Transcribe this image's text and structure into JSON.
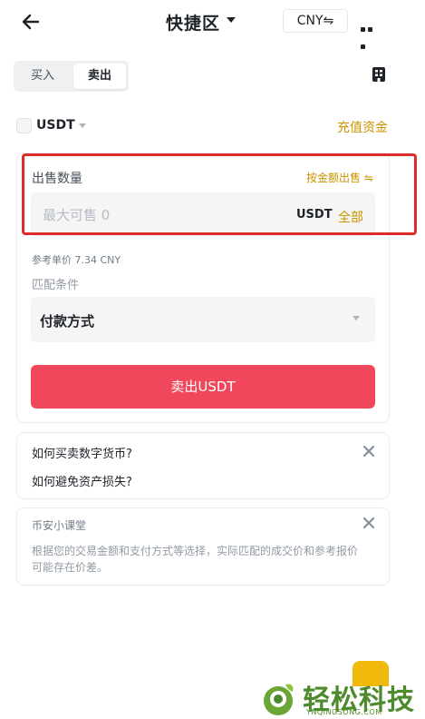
{
  "header": {
    "title": "快捷区",
    "currency_button": "CNY⇋"
  },
  "tabs": [
    {
      "label": "买入",
      "active": false
    },
    {
      "label": "卖出",
      "active": true
    }
  ],
  "coin_row": {
    "coin": "USDT",
    "recharge_link": "充值资金"
  },
  "sell_form": {
    "quantity_label": "出售数量",
    "by_amount_link": "按金额出售 ⇋",
    "quantity_placeholder": "最大可售 0",
    "unit": "USDT",
    "all_button": "全部",
    "reference_price": "参考单价 7.34 CNY",
    "match_label": "匹配条件",
    "payment_method": "付款方式",
    "submit_button": "卖出USDT"
  },
  "faq": {
    "items": [
      "如何买卖数字货币?",
      "如何避免资产损失?"
    ]
  },
  "tip": {
    "title": "币安小课堂",
    "body": "根据您的交易金额和支付方式等选择，实际匹配的成交价和参考报价可能存在价差。"
  },
  "watermark": {
    "text": "轻松科技",
    "url": "YNQINGSONG.COM"
  },
  "colors": {
    "accent": "#c99400",
    "sell_button": "#f0475c",
    "highlight_frame": "#e02a2a",
    "watermark_green": "#4c8a2c"
  }
}
